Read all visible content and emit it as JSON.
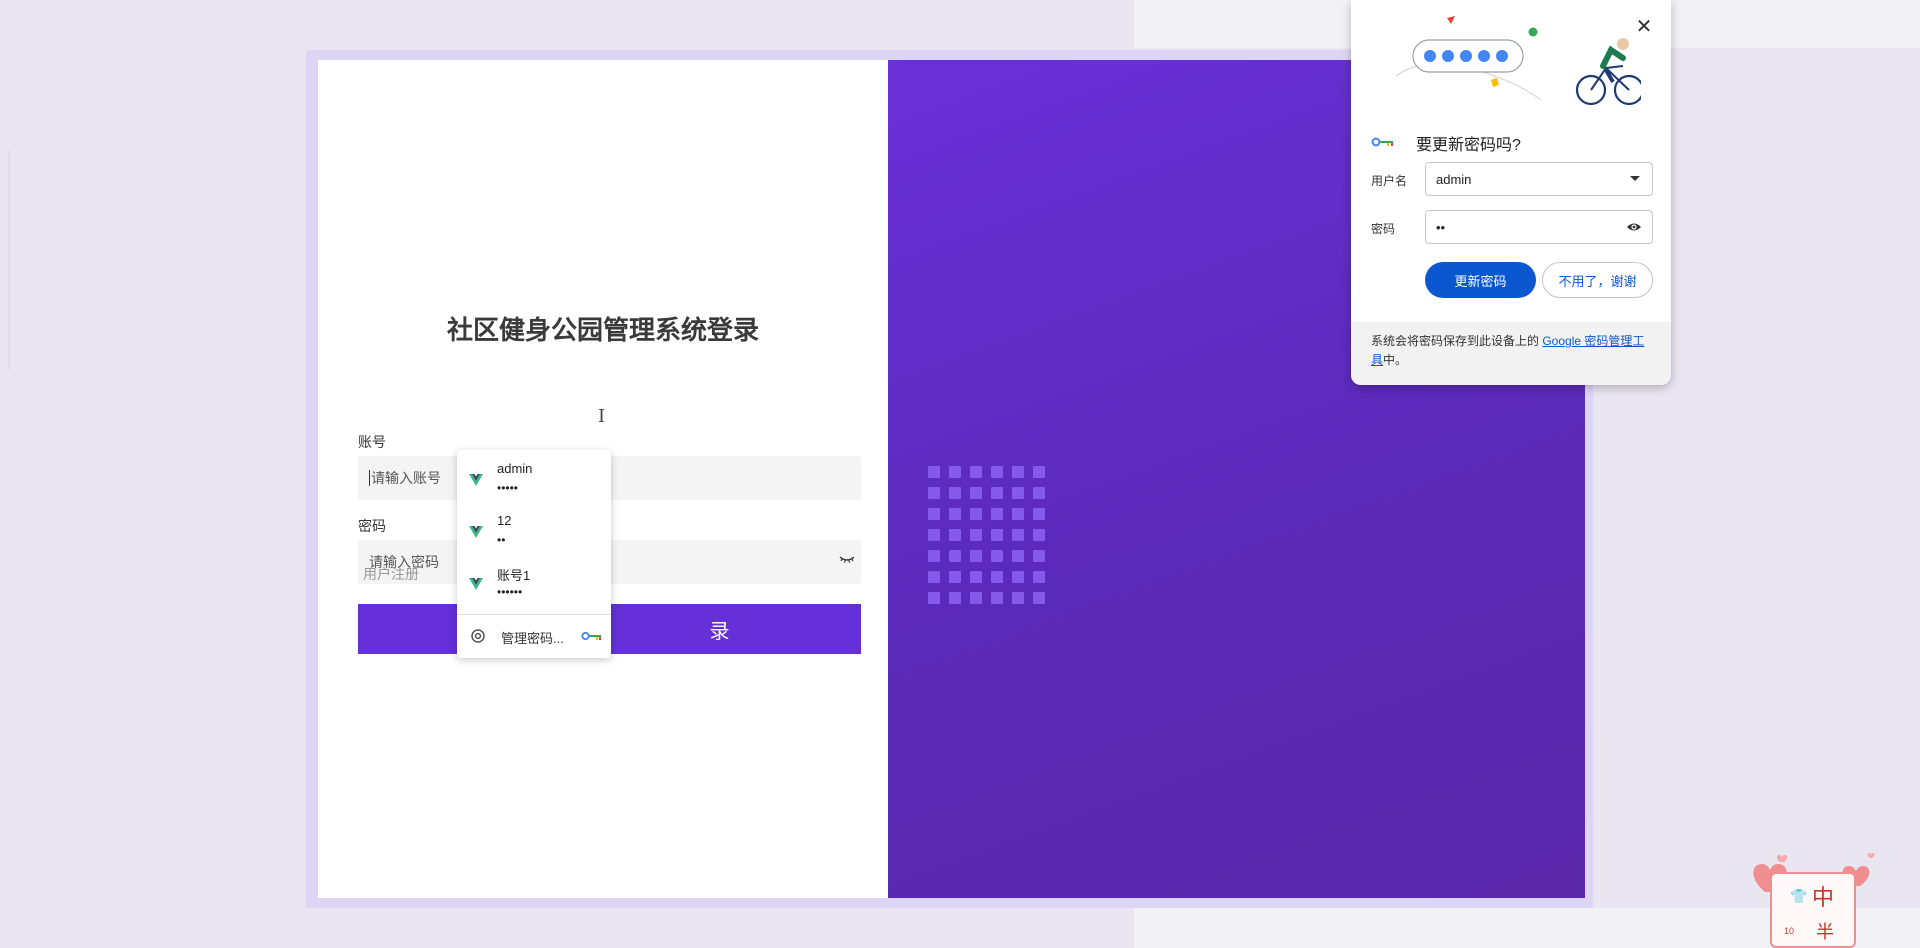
{
  "login": {
    "title": "社区健身公园管理系统登录",
    "account_label": "账号",
    "account_placeholder": "请输入账号",
    "password_label": "密码",
    "password_placeholder": "请输入密码",
    "register_link": "用户注册",
    "login_button_visible": "录"
  },
  "autofill": {
    "items": [
      {
        "username": "admin",
        "password": "•••••"
      },
      {
        "username": "12",
        "password": "••"
      },
      {
        "username": "账号1",
        "password": "••••••"
      }
    ],
    "manage_label": "管理密码..."
  },
  "password_popup": {
    "title": "要更新密码吗?",
    "username_label": "用户名",
    "username_value": "admin",
    "password_label": "密码",
    "password_value": "••",
    "update_button": "更新密码",
    "cancel_button": "不用了，谢谢",
    "footer_text": "系统会将密码保存到此设备上的 ",
    "footer_link": "Google 密码管理工具",
    "footer_suffix": "中。"
  },
  "corner_widget": {
    "char_top": "中",
    "char_bottom": "半",
    "small_text": "10"
  },
  "colors": {
    "accent": "#6530d8",
    "brand_blue": "#0b57d0",
    "gradient_start": "#6a30d9",
    "gradient_end": "#5a27a8"
  }
}
